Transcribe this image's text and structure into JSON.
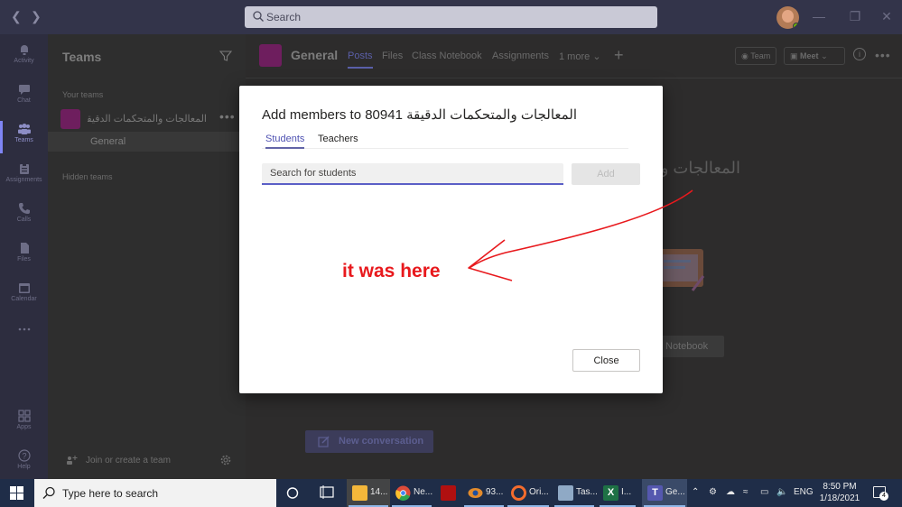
{
  "titlebar": {
    "search_placeholder": "Search"
  },
  "rail": {
    "items": [
      {
        "label": "Activity",
        "icon": "bell-icon"
      },
      {
        "label": "Chat",
        "icon": "chat-icon"
      },
      {
        "label": "Teams",
        "icon": "teams-icon"
      },
      {
        "label": "Assignments",
        "icon": "assignments-icon"
      },
      {
        "label": "Calls",
        "icon": "phone-icon"
      },
      {
        "label": "Files",
        "icon": "file-icon"
      },
      {
        "label": "Calendar",
        "icon": "calendar-icon"
      },
      {
        "label": "Apps",
        "icon": "apps-icon"
      },
      {
        "label": "Help",
        "icon": "help-icon"
      }
    ]
  },
  "teams_panel": {
    "title": "Teams",
    "your_teams_label": "Your teams",
    "team_name": "المعالجات والمتحكمات الدقيقة ...",
    "channel": "General",
    "hidden_teams_label": "Hidden teams",
    "join_label": "Join or create a team"
  },
  "main": {
    "channel_title": "General",
    "tabs": [
      "Posts",
      "Files",
      "Class Notebook",
      "Assignments",
      "1 more"
    ],
    "team_button": "Team",
    "meet_button": "Meet",
    "background_heading": "المعالجات و",
    "notebook_button": "Notebook",
    "new_conversation": "New conversation"
  },
  "dialog": {
    "title_prefix": "Add members to",
    "title_team": "المعالجات والمتحكمات الدقيقة 80941",
    "tabs": [
      "Students",
      "Teachers"
    ],
    "search_placeholder": "Search for students",
    "add_label": "Add",
    "close_label": "Close",
    "annotation": "it was here",
    "annotation_color": "#e8191d",
    "accent_color": "#6264a7"
  },
  "taskbar": {
    "search_placeholder": "Type here to search",
    "apps": [
      {
        "label": "14...",
        "icon": "file-explorer-icon",
        "color": "#f4b73a"
      },
      {
        "label": "Ne...",
        "icon": "chrome-icon",
        "color": "#dd4b39"
      },
      {
        "label": "",
        "icon": "game-app-icon",
        "color": "#b01010"
      },
      {
        "label": "93...",
        "icon": "eye-app-icon",
        "color": "#e38b2c"
      },
      {
        "label": "Ori...",
        "icon": "origin-icon",
        "color": "#f56c2d"
      },
      {
        "label": "Tas...",
        "icon": "task-manager-icon",
        "color": "#8fa9c5"
      },
      {
        "label": "I...",
        "icon": "excel-icon",
        "color": "#1e7145"
      },
      {
        "label": "Ge...",
        "icon": "teams-app-icon",
        "color": "#5558af"
      }
    ],
    "language": "ENG",
    "time": "8:50 PM",
    "date": "1/18/2021",
    "notifications": "4"
  }
}
